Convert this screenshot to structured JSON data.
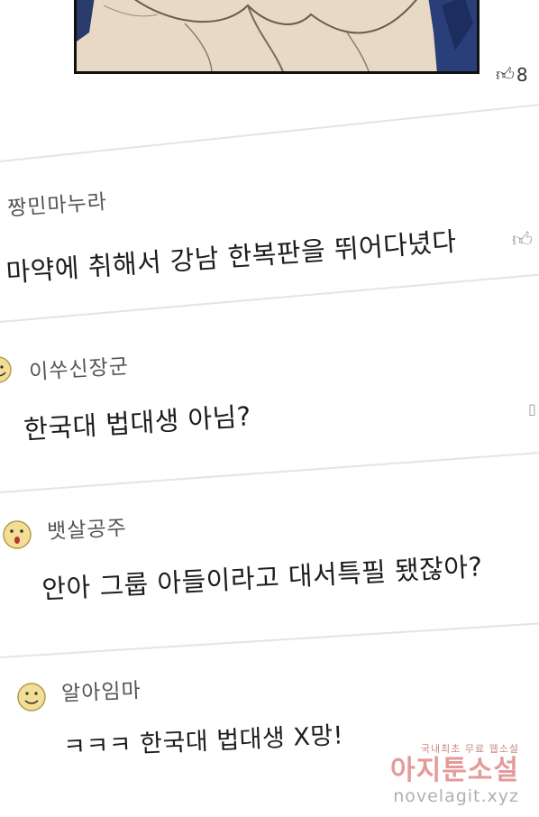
{
  "top_like": {
    "count": "8"
  },
  "comments": [
    {
      "username": "짱민마누라",
      "text": "마약에 취해서 강남 한복판을 뛰어다녔다"
    },
    {
      "username": "이쑤신장군",
      "text": "한국대 법대생 아님?"
    },
    {
      "username": "뱃살공주",
      "text": "안아 그룹 아들이라고 대서특필 됐잖아?"
    },
    {
      "username": "알아임마",
      "text": "ㅋㅋㅋ 한국대 법대생 X망!"
    }
  ],
  "watermark": {
    "tagline": "국내최초 무료 웹소설",
    "brand": "아지툰소설",
    "url": "novelagit.xyz"
  },
  "icons": [
    "thumbs-up-icon",
    "smiley-avatar-icon",
    "surprised-avatar-icon"
  ],
  "colors": {
    "avatar": "#f3de96",
    "watermark": "#e59a9a"
  }
}
